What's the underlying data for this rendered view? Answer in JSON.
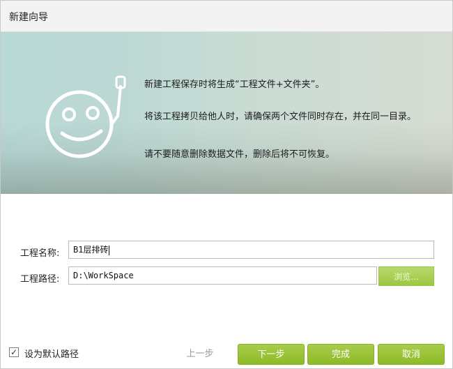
{
  "window": {
    "title": "新建向导"
  },
  "banner": {
    "tips": [
      "新建工程保存时将生成“工程文件+文件夹”。",
      "将该工程拷贝给他人时，请确保两个文件同时存在，并在同一目录。",
      "请不要随意删除数据文件，删除后将不可恢复。"
    ],
    "mascot_icon": "smiley-robot-icon"
  },
  "form": {
    "name_label": "工程名称:",
    "name_value": "B1层排砖",
    "path_label": "工程路径:",
    "path_value": "D:\\WorkSpace",
    "browse_label": "浏览..."
  },
  "footer": {
    "default_path_label": "设为默认路径",
    "default_path_checked": true,
    "prev_label": "上一步",
    "next_label": "下一步",
    "finish_label": "完成",
    "cancel_label": "取消"
  },
  "colors": {
    "accent_green": "#97c33a",
    "banner_teal": "#bcd8d4"
  }
}
